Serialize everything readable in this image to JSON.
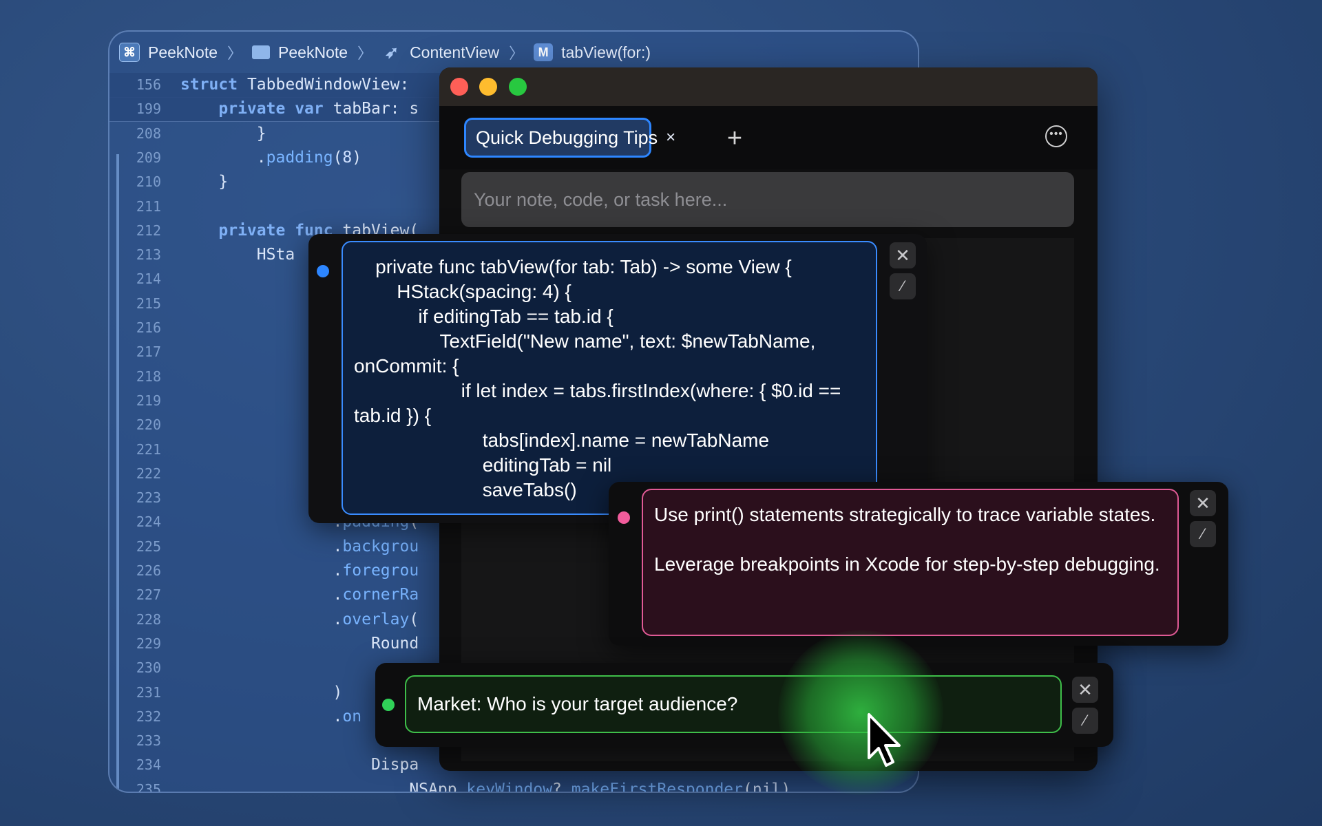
{
  "breadcrumb": {
    "items": [
      "PeekNote",
      "PeekNote",
      "ContentView",
      "tabView(for:)"
    ],
    "separator": "〉",
    "method_badge": "M"
  },
  "editor": {
    "lines": [
      {
        "n": "156",
        "code": "struct TabbedWindowView: "
      },
      {
        "n": "199",
        "code": "    private var tabBar: s"
      },
      {
        "n": "208",
        "code": "        }"
      },
      {
        "n": "209",
        "code": "        .padding(8)"
      },
      {
        "n": "210",
        "code": "    }"
      },
      {
        "n": "211",
        "code": ""
      },
      {
        "n": "212",
        "code": "    private func tabView("
      },
      {
        "n": "213",
        "code": "        HSta"
      },
      {
        "n": "214",
        "code": ""
      },
      {
        "n": "215",
        "code": ""
      },
      {
        "n": "216",
        "code": ""
      },
      {
        "n": "217",
        "code": ""
      },
      {
        "n": "218",
        "code": ""
      },
      {
        "n": "219",
        "code": ""
      },
      {
        "n": "220",
        "code": ""
      },
      {
        "n": "221",
        "code": ""
      },
      {
        "n": "222",
        "code": ""
      },
      {
        "n": "223",
        "code": ""
      },
      {
        "n": "224",
        "code": "                .padding("
      },
      {
        "n": "225",
        "code": "                .backgrou"
      },
      {
        "n": "226",
        "code": "                .foregrou"
      },
      {
        "n": "227",
        "code": "                .cornerRa"
      },
      {
        "n": "228",
        "code": "                .overlay("
      },
      {
        "n": "229",
        "code": "                    Round"
      },
      {
        "n": "230",
        "code": ""
      },
      {
        "n": "231",
        "code": "                )"
      },
      {
        "n": "232",
        "code": "                .on"
      },
      {
        "n": "233",
        "code": ""
      },
      {
        "n": "234",
        "code": "                    Dispa"
      },
      {
        "n": "235",
        "code": "                        NSApp.keyWindow?.makeFirstResponder(nil)"
      }
    ]
  },
  "peeknote": {
    "active_tab": "Quick Debugging Tips",
    "tab_close": "×",
    "add_tab": "+",
    "more": "•••",
    "input_placeholder": "Your note, code, or task here...",
    "notes": [
      {
        "color": "#3a8cff",
        "lines": [
          "    private func tabView(for tab: Tab) -> some View {",
          "        HStack(spacing: 4) {",
          "            if editingTab == tab.id {",
          "                TextField(\"New name\", text: $newTabName, onCommit: {",
          "                    if let index = tabs.firstIndex(where: { $0.id == tab.id }) {",
          "                        tabs[index].name = newTabName",
          "                        editingTab = nil",
          "                        saveTabs()"
        ]
      },
      {
        "color": "#e05a95",
        "text": "Use print() statements strategically to trace variable states.\n\nLeverage breakpoints in Xcode for step-by-step debugging."
      },
      {
        "color": "#3fbf4a",
        "text": "Market: Who is your target audience?"
      }
    ],
    "close_glyph": "✕",
    "edit_glyph": "⁄"
  }
}
